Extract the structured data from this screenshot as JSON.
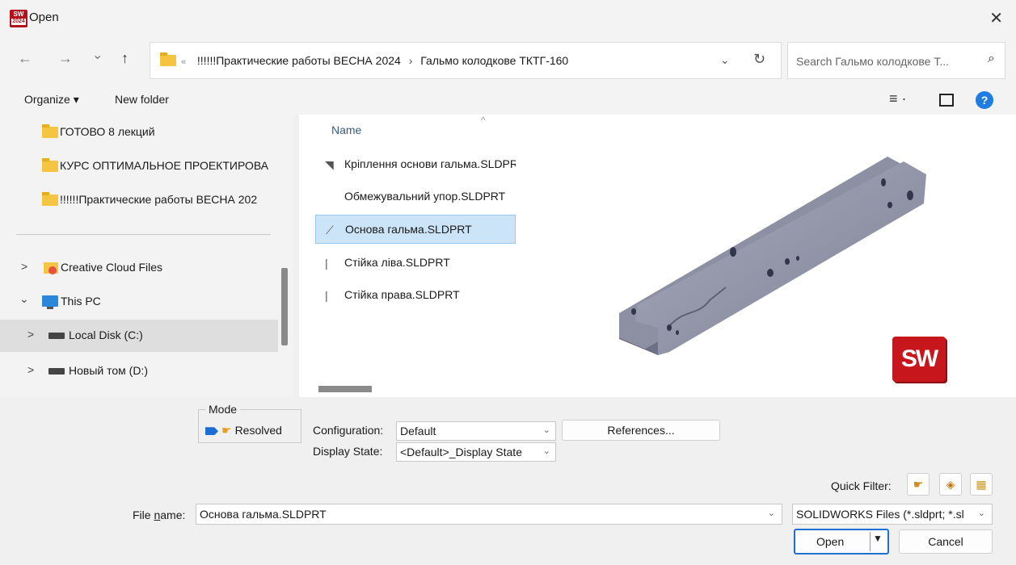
{
  "window": {
    "title": "Open",
    "app_icon_text": "SW",
    "app_icon_year": "2024",
    "close_glyph": "✕"
  },
  "nav": {
    "back_glyph": "←",
    "forward_glyph": "→",
    "recent_glyph": "⌄",
    "up_glyph": "↑",
    "crumb_overflow": "«",
    "crumbs": [
      "!!!!!!Практические работы ВЕСНА 2024",
      "Гальмо колодкове ТКТГ-160"
    ],
    "crumb_sep": "›",
    "dropdown_glyph": "⌄",
    "refresh_glyph": "↻",
    "search_placeholder": "Search Гальмо колодкове Т...",
    "search_glyph": "⌕"
  },
  "toolbar": {
    "organize": "Organize ▾",
    "new_folder": "New folder",
    "view_glyph": "≡ ·",
    "help_glyph": "?"
  },
  "tree": {
    "items": [
      {
        "label": "ГОТОВО 8 лекций",
        "icon": "folder-icon"
      },
      {
        "label": "КУРС ОПТИМАЛЬНОЕ ПРОЕКТИРОВА",
        "icon": "folder-icon"
      },
      {
        "label": "!!!!!!Практические работы ВЕСНА 202",
        "icon": "folder-icon"
      },
      {
        "label": "Creative Cloud Files",
        "icon": "creative-cloud-icon",
        "arrow": ">"
      },
      {
        "label": "This PC",
        "icon": "computer-icon",
        "arrow": "⌄"
      },
      {
        "label": "Local Disk (C:)",
        "icon": "disk-icon",
        "arrow": ">"
      },
      {
        "label": "Новый том (D:)",
        "icon": "disk-icon",
        "arrow": ">"
      }
    ]
  },
  "files": {
    "column_name": "Name",
    "sort_glyph": "^",
    "rows": [
      {
        "name": "Кріплення  основи гальма.SLDPRT",
        "icon_glyph": "◥"
      },
      {
        "name": "Обмежувальний упор.SLDPRT",
        "icon_glyph": ""
      },
      {
        "name": "Основа гальма.SLDPRT",
        "icon_glyph": "⟋"
      },
      {
        "name": "Стійка ліва.SLDPRT",
        "icon_glyph": "|"
      },
      {
        "name": "Стійка права.SLDPRT",
        "icon_glyph": "|"
      }
    ]
  },
  "preview": {
    "logo_text": "SW"
  },
  "bottom": {
    "mode_label": "Mode",
    "mode_value": "Resolved",
    "configuration_label": "Configuration:",
    "configuration_value": "Default",
    "display_state_label": "Display State:",
    "display_state_value": "<Default>_Display State",
    "references_label": "References...",
    "quick_filter_label": "Quick Filter:",
    "file_name_label_pre": "File ",
    "file_name_label_underlined": "n",
    "file_name_label_post": "ame:",
    "file_name_value": "Основа гальма.SLDPRT",
    "file_type_value": "SOLIDWORKS Files (*.sldprt; *.sl",
    "open_label": "Open",
    "cancel_label": "Cancel",
    "dropdown_glyph": "⌄"
  },
  "colors": {
    "accent": "#1f6fd0",
    "selection": "#cce4f7",
    "folder": "#f5c542",
    "solidworks_red": "#c8161d"
  }
}
